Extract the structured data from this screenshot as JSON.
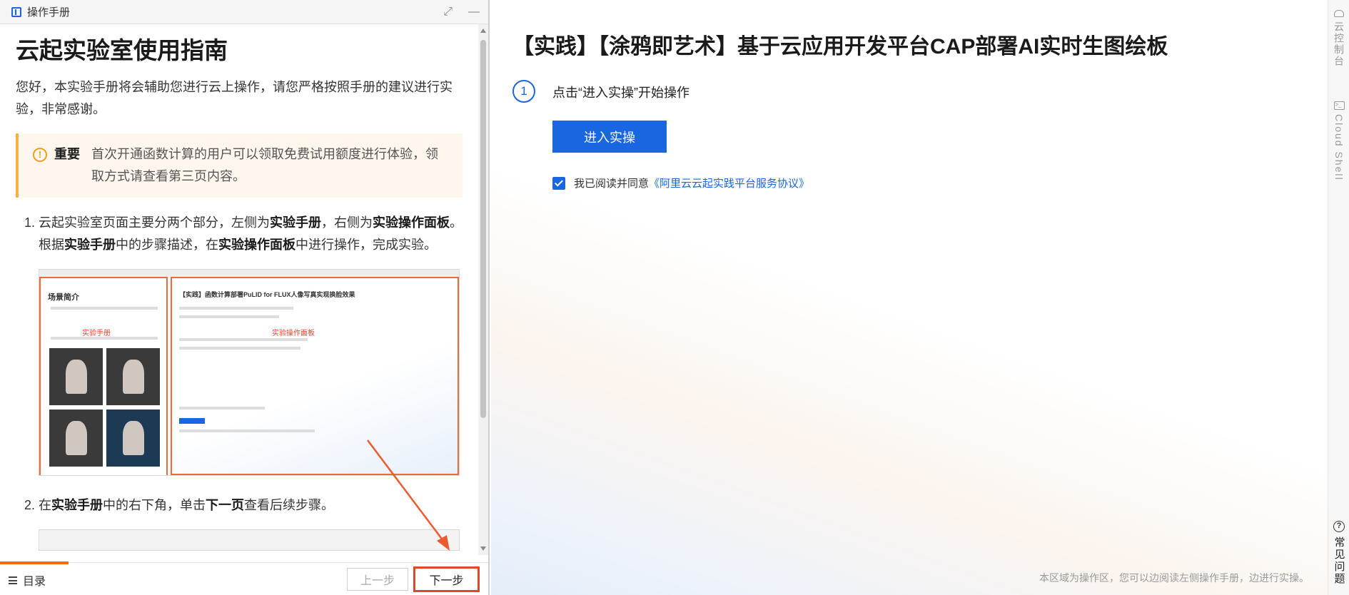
{
  "manual": {
    "header_title": "操作手册",
    "guide_title": "云起实验室使用指南",
    "intro": "您好，本实验手册将会辅助您进行云上操作，请您严格按照手册的建议进行实验，非常感谢。",
    "notice": {
      "label": "重要",
      "text": "首次开通函数计算的用户可以领取免费试用额度进行体验，领取方式请查看第三页内容。"
    },
    "step1": {
      "p1": "云起实验室页面主要分两个部分，左侧为",
      "b1": "实验手册",
      "p2": "，右侧为",
      "b2": "实验操作面板",
      "p3": "。根据",
      "b3": "实验手册",
      "p4": "中的步骤描述，在",
      "b4": "实验操作面板",
      "p5": "中进行操作，完成实验。"
    },
    "screenshot": {
      "left_title": "场景简介",
      "left_tag": "实验手册",
      "right_title": "【实践】函数计算部署PuLID for FLUX人像写真实现换脸效果",
      "right_tag": "实验操作面板"
    },
    "step2": {
      "p1": "在",
      "b1": "实验手册",
      "p2": "中的右下角，单击",
      "b2": "下一页",
      "p3": "查看后续步骤。"
    },
    "footer": {
      "toc_label": "目录",
      "prev_label": "上一步",
      "next_label": "下一步"
    }
  },
  "operation": {
    "title": "【实践】【涂鸦即艺术】基于云应用开发平台CAP部署AI实时生图绘板",
    "step_number": "1",
    "step_text": "点击“进入实操”开始操作",
    "enter_button": "进入实操",
    "agree_text": "我已阅读并同意",
    "agree_link": "《阿里云云起实践平台服务协议》",
    "agree_checked": true,
    "footer_note": "本区域为操作区，您可以边阅读左侧操作手册，边进行实操。"
  },
  "rail": {
    "console": "云控制台",
    "cloud_shell": "Cloud Shell",
    "faq": "常见问题"
  },
  "colors": {
    "accent": "#1a66e0",
    "highlight": "#e3452b",
    "notice_bg": "#fff7ee",
    "notice_border": "#f5b24a"
  }
}
